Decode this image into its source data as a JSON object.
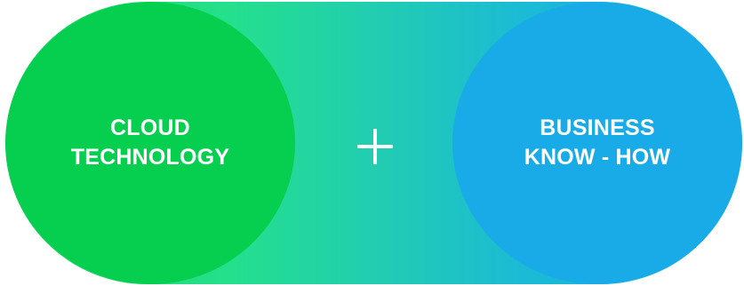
{
  "left_circle": {
    "line1": "CLOUD",
    "line2": "TECHNOLOGY",
    "color": "#06cf4f"
  },
  "operator": {
    "icon": "plus-icon"
  },
  "right_circle": {
    "line1": "BUSINESS",
    "line2": "KNOW - HOW",
    "color": "#19abe7"
  },
  "gradient_colors": [
    "#1fd45e",
    "#24e08c",
    "#22cdb0",
    "#1bbbd5",
    "#17a9e6"
  ]
}
